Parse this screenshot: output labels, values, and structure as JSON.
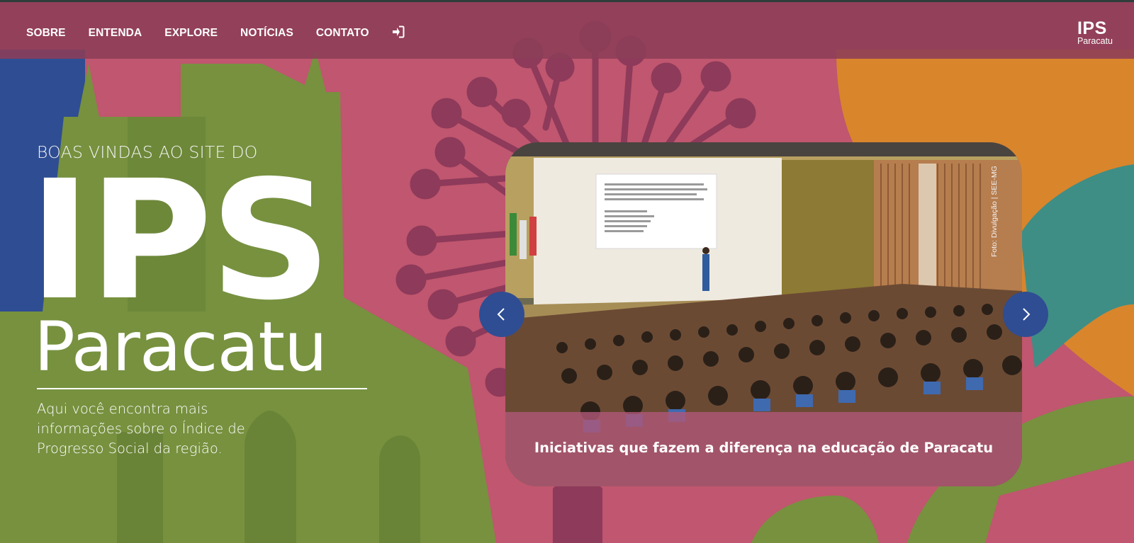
{
  "nav": {
    "items": [
      {
        "label": "SOBRE"
      },
      {
        "label": "ENTENDA"
      },
      {
        "label": "EXPLORE"
      },
      {
        "label": "NOTÍCIAS"
      },
      {
        "label": "CONTATO"
      }
    ],
    "login_icon": "login-icon"
  },
  "logo": {
    "title": "IPS",
    "subtitle": "Paracatu"
  },
  "hero": {
    "welcome": "BOAS VINDAS AO SITE DO",
    "title": "IPS",
    "city": "Paracatu",
    "description": "Aqui você encontra mais informações sobre o Índice de Progresso Social da região."
  },
  "carousel": {
    "caption": "Iniciativas que fazem a diferença na educação de Paracatu",
    "photo_credit": "Foto: Divulgação | SEE-MG",
    "prev_icon": "chevron-left-icon",
    "next_icon": "chevron-right-icon"
  },
  "colors": {
    "nav_bg": "#8c3e58",
    "pink": "#c0566f",
    "green": "#77913f",
    "blue": "#2f4d92",
    "orange": "#d9852c",
    "teal": "#3e8e86",
    "dark_magenta": "#8e3a5a",
    "button_blue": "#2f4d92"
  }
}
